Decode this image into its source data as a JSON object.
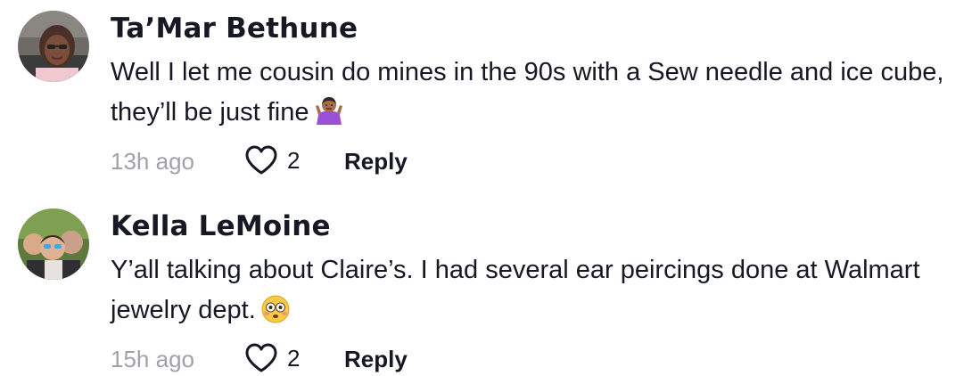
{
  "comments": [
    {
      "username": "Ta’Mar Bethune",
      "text": "Well I let me cousin do mines in the 90s with a Sew needle and ice cube, they’ll be just fine",
      "emoji": "person-shrugging-emoji",
      "timestamp": "13h ago",
      "likes": "2",
      "reply_label": "Reply"
    },
    {
      "username": "Kella LeMoine",
      "text": "Y’all talking about Claire’s. I had several ear peircings done at Walmart jewelry dept.",
      "emoji": "flushed-face-emoji",
      "timestamp": "15h ago",
      "likes": "2",
      "reply_label": "Reply"
    }
  ],
  "icons": {
    "like": "heart-outline-icon"
  },
  "colors": {
    "text_primary": "#161823",
    "text_secondary": "#a1a2a7",
    "shrug_emoji": "#9b4fd6",
    "flushed_emoji": "#f7c948"
  }
}
